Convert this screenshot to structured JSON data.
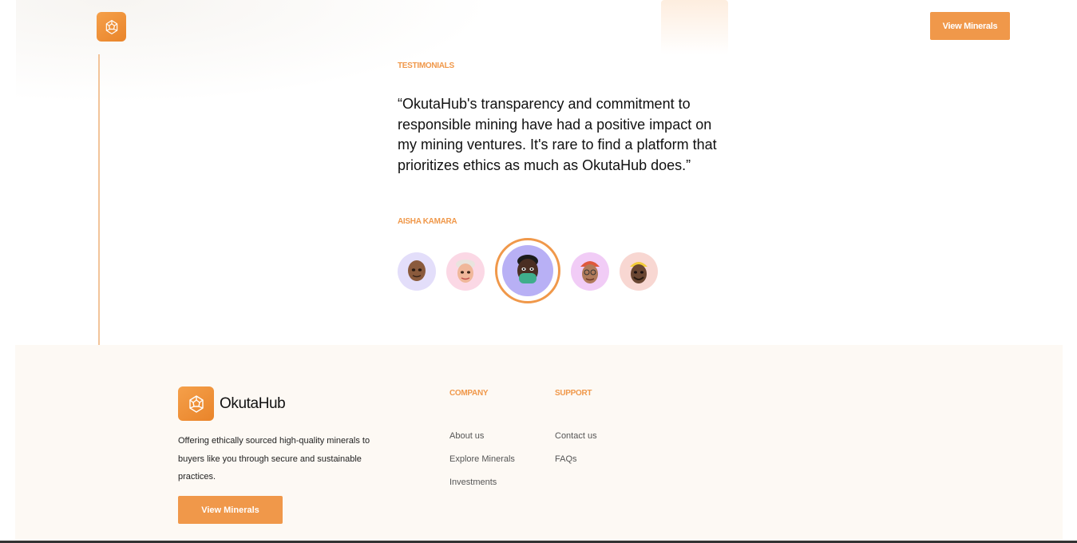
{
  "header": {
    "logo_icon": "gem-icon",
    "cta_label": "View Minerals"
  },
  "testimonials": {
    "section_label": "TESTIMONIALS",
    "quote": "“OkutaHub's transparency and commitment to responsible mining have had a positive impact on my mining ventures. It's rare to find a platform that prioritizes ethics as much as OkutaHub does.”",
    "author": "AISHA KAMARA",
    "avatars": [
      "avatar-memoji-1",
      "avatar-memoji-2",
      "avatar-memoji-3-selected",
      "avatar-memoji-4",
      "avatar-memoji-5"
    ]
  },
  "footer": {
    "brand": "OkutaHub",
    "description": "Offering ethically sourced high-quality minerals to buyers like you through secure and sustainable practices.",
    "cta_label": "View Minerals",
    "company": {
      "heading": "COMPANY",
      "links": [
        "About us",
        "Explore Minerals",
        "Investments"
      ]
    },
    "support": {
      "heading": "SUPPORT",
      "links": [
        "Contact us",
        "FAQs"
      ]
    }
  },
  "colors": {
    "accent": "#f0984a",
    "footer_bg": "#fdf9f4"
  }
}
